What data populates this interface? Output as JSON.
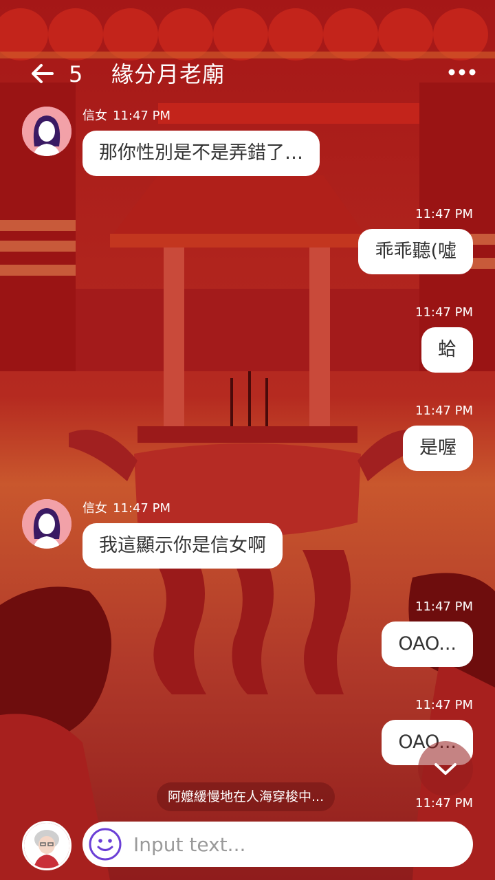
{
  "header": {
    "unread_count": "5",
    "title": "緣分月老廟",
    "back_icon": "arrow-left-icon",
    "more_icon": "more-horizontal-icon"
  },
  "messages": [
    {
      "direction": "in",
      "sender": "信女",
      "time": "11:47 PM",
      "text": "那你性別是不是弄錯了…"
    },
    {
      "direction": "out",
      "time": "11:47 PM",
      "text": "乖乖聽(噓"
    },
    {
      "direction": "out",
      "time": "11:47 PM",
      "text": "蛤"
    },
    {
      "direction": "out",
      "time": "11:47 PM",
      "text": "是喔"
    },
    {
      "direction": "in",
      "sender": "信女",
      "time": "11:47 PM",
      "text": "我這顯示你是信女啊"
    },
    {
      "direction": "out",
      "time": "11:47 PM",
      "text": "OAO..."
    },
    {
      "direction": "out",
      "time": "11:47 PM",
      "text": "OAO..."
    },
    {
      "direction": "out",
      "time": "11:47 PM",
      "text": ""
    }
  ],
  "toast": "阿嬤緩慢地在人海穿梭中...",
  "input": {
    "placeholder": "Input text...",
    "value": ""
  },
  "icons": {
    "emoji": "smiley-icon",
    "scroll": "chevron-down-icon"
  },
  "colors": {
    "background": "#8e1a1a",
    "bubble": "#ffffff",
    "accent_purple": "#6b3fd6",
    "avatar_pink": "#f2a1a8"
  }
}
